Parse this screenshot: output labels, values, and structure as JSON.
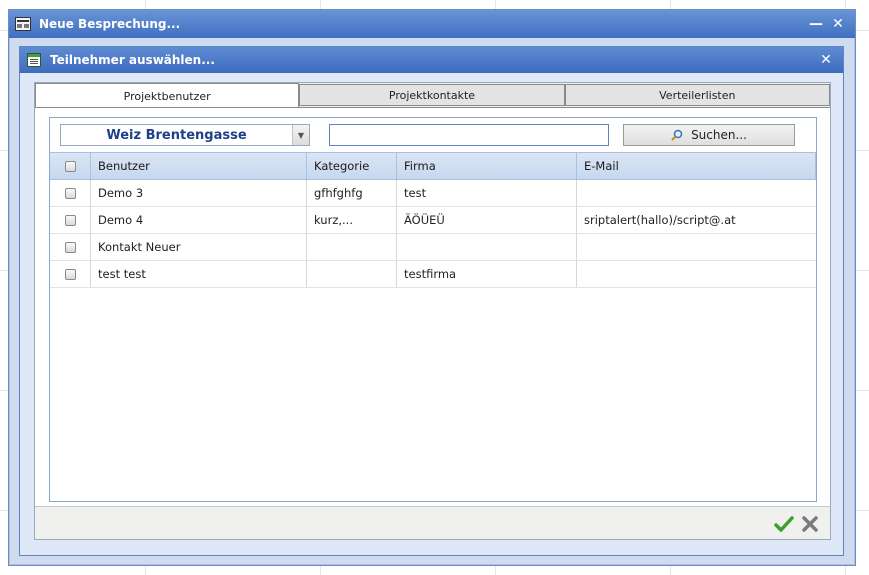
{
  "outer_window": {
    "title": "Neue Besprechung...",
    "minimize_glyph": "—",
    "close_glyph": "✕"
  },
  "dialog": {
    "title": "Teilnehmer auswählen...",
    "close_glyph": "✕"
  },
  "tabs": [
    {
      "label": "Projektbenutzer",
      "active": true
    },
    {
      "label": "Projektkontakte",
      "active": false
    },
    {
      "label": "Verteilerlisten",
      "active": false
    }
  ],
  "toolbar": {
    "location_select_value": "Weiz Brentengasse",
    "search_input_value": "",
    "search_button_label": "Suchen..."
  },
  "grid": {
    "columns": [
      "Benutzer",
      "Kategorie",
      "Firma",
      "E-Mail"
    ],
    "rows": [
      {
        "benutzer": "Demo 3",
        "kategorie": "gfhfghfg",
        "firma": "test",
        "email": ""
      },
      {
        "benutzer": "Demo 4",
        "kategorie": "kurz,...",
        "firma": "ÄÖÜEÜ",
        "email": "sriptalert(hallo)/script@.at"
      },
      {
        "benutzer": "Kontakt Neuer",
        "kategorie": "",
        "firma": "",
        "email": ""
      },
      {
        "benutzer": "test test",
        "kategorie": "",
        "firma": "testfirma",
        "email": ""
      }
    ]
  },
  "icons": {
    "window": "meeting-window-icon",
    "dialog": "list-window-icon",
    "search": "magnifier-icon",
    "ok": "green-check-icon",
    "cancel": "grey-x-icon"
  },
  "colors": {
    "title_bar": "#3f6fc0",
    "accent_text": "#1f3f86",
    "ok_green": "#3aa12b"
  }
}
